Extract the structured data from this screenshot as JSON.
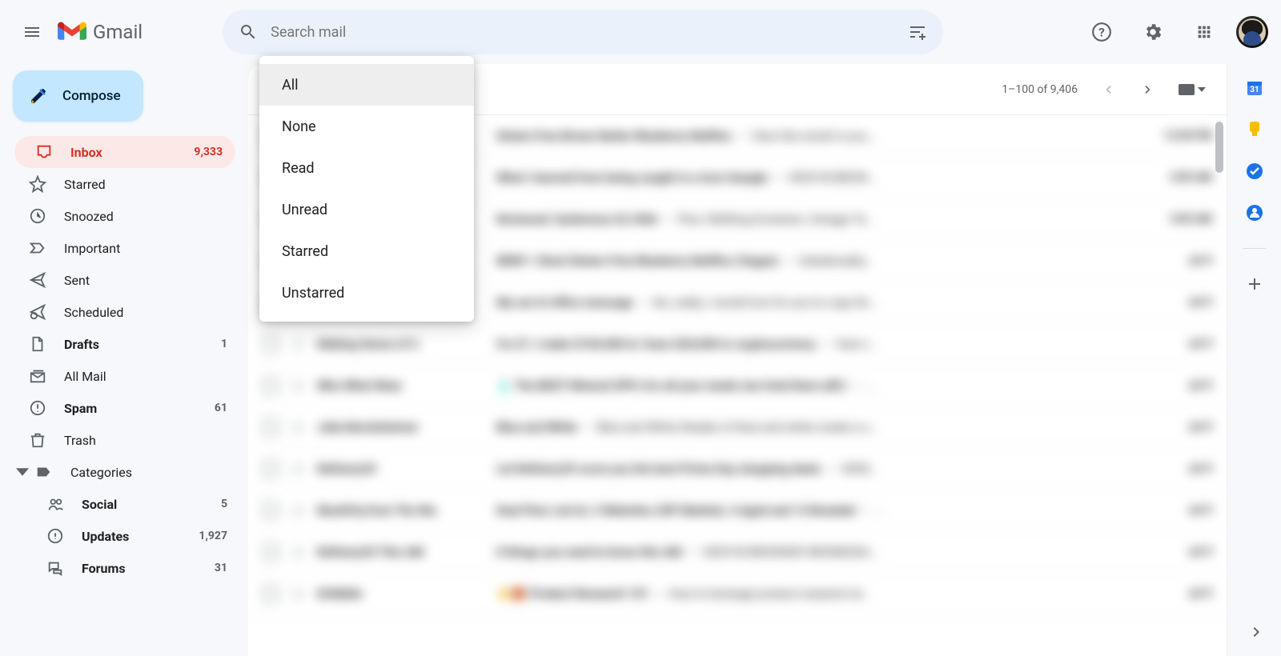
{
  "header": {
    "product_name": "Gmail",
    "search_placeholder": "Search mail"
  },
  "compose_label": "Compose",
  "sidebar": {
    "items": [
      {
        "label": "Inbox",
        "count": "9,333",
        "icon": "inbox",
        "active": true,
        "bold": true
      },
      {
        "label": "Starred",
        "count": "",
        "icon": "star"
      },
      {
        "label": "Snoozed",
        "count": "",
        "icon": "clock"
      },
      {
        "label": "Important",
        "count": "",
        "icon": "important"
      },
      {
        "label": "Sent",
        "count": "",
        "icon": "send"
      },
      {
        "label": "Scheduled",
        "count": "",
        "icon": "schedule"
      },
      {
        "label": "Drafts",
        "count": "1",
        "icon": "draft",
        "bold": true
      },
      {
        "label": "All Mail",
        "count": "",
        "icon": "allmail"
      },
      {
        "label": "Spam",
        "count": "61",
        "icon": "spam",
        "bold": true
      },
      {
        "label": "Trash",
        "count": "",
        "icon": "trash"
      },
      {
        "label": "Categories",
        "count": "",
        "icon": "label",
        "expandable": true
      }
    ],
    "categories": [
      {
        "label": "Social",
        "count": "5",
        "icon": "social",
        "bold": true
      },
      {
        "label": "Updates",
        "count": "1,927",
        "icon": "updates",
        "bold": true
      },
      {
        "label": "Forums",
        "count": "31",
        "icon": "forums",
        "bold": true
      }
    ]
  },
  "toolbar": {
    "page_info": "1–100 of 9,406"
  },
  "select_menu": {
    "items": [
      "All",
      "None",
      "Read",
      "Unread",
      "Starred",
      "Unstarred"
    ],
    "highlighted_index": 0
  },
  "emails": [
    {
      "sender": "Sally's Baking",
      "subject": "Gluten Free Brown Butter Blueberry Muffins",
      "preview": "View this email in you...",
      "date": "12:00 PM"
    },
    {
      "sender": "Refinery29",
      "subject": "What I learned from being caught in a love triangle",
      "preview": "VIEW IN BROW...",
      "date": "4:00 AM"
    },
    {
      "sender": "The Verge",
      "subject": "Reviewed: Sanbrenzo SL100A",
      "preview": "Plus: Refitting Evolution, Vintage Te...",
      "date": "3:00 AM"
    },
    {
      "sender": "Sally's Baking",
      "subject": "NEW! 1-Bowl Gluten-Free Blueberry Muffins (Vegan)",
      "preview": "Unbelievably...",
      "date": "Jul 9"
    },
    {
      "sender": "Ann Handley",
      "subject": "My out of office message",
      "preview": "No, really, I would love for you to copy thi...",
      "date": "Jul 9"
    },
    {
      "sender": "Making Sense of C.",
      "subject": "I'm 27, I make $105,000 & I have $20,000 in cryptocurrency",
      "preview": "View t...",
      "date": "Jul 9"
    },
    {
      "sender": "Who What Wear",
      "subject": "The BEST Mineral SPFs for all your needs (we tried them all!!)",
      "preview": "...",
      "date": "Jul 9",
      "emoji": "🧴"
    },
    {
      "sender": "Julia Berolzheimer",
      "subject": "Blue and White",
      "preview": "Blue and White Shades of blue and white create a s...",
      "date": "Jul 9"
    },
    {
      "sender": "Refinery29",
      "subject": "Let Refinery29 score you the best Prime Day shopping deals",
      "preview": "VIEW...",
      "date": "Jul 9"
    },
    {
      "sender": "MushFiq from The We.",
      "subject": "Deal Flow (Jul 6): 2 Websites (Off-Market), 4 Aged and 13 Branded",
      "preview": "...",
      "date": "Jul 9"
    },
    {
      "sender": "Refinery29 This AM",
      "subject": "8 things you need to know this AM",
      "preview": "VIEW IN BROWSER WEDNESDA...",
      "date": "Jul 9"
    },
    {
      "sender": "Dribbble",
      "subject": "Product Research 101",
      "preview": "How to leverage product research at...",
      "date": "Jul 9",
      "emoji": "👋🏀"
    }
  ]
}
